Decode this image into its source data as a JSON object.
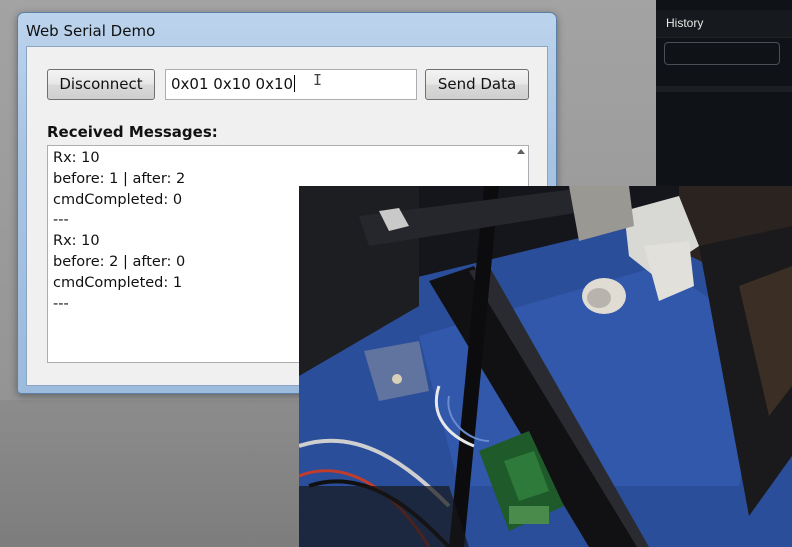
{
  "dark_panel": {
    "tab_label": "History"
  },
  "window": {
    "title": "Web Serial Demo",
    "disconnect_label": "Disconnect",
    "input_value": "0x01 0x10 0x10",
    "send_label": "Send Data",
    "received_label": "Received Messages:",
    "messages": [
      "Rx: 10",
      "before: 1 | after: 2",
      "cmdCompleted: 0",
      "---",
      "Rx: 10",
      "before: 2 | after: 0",
      "cmdCompleted: 1",
      "---"
    ]
  },
  "photo": {
    "subject": "3D printer gantry on blue build plate with control board"
  },
  "colors": {
    "window_frame": "#a6c3e2",
    "client_bg": "#f0f0f0",
    "dark_panel": "#0f1216",
    "build_plate": "#2a4f9e"
  }
}
